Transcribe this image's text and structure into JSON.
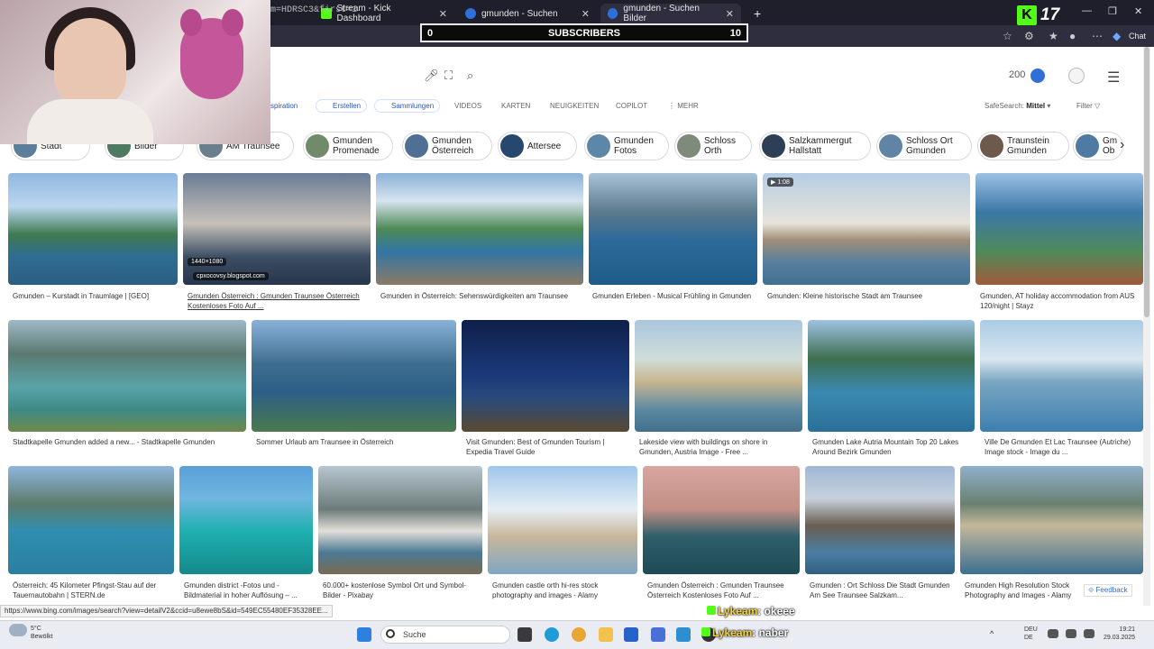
{
  "browser": {
    "tabs": [
      {
        "label": "Stream - Kick Dashboard",
        "active": false
      },
      {
        "label": "gmunden - Suchen",
        "active": false
      },
      {
        "label": "gmunden - Suchen Bilder",
        "active": true
      }
    ],
    "url_fragment": "m=HDRSC3&first=1",
    "new_tab_icon": "+",
    "chat_label": "Chat"
  },
  "overlay": {
    "subs_left": "0",
    "subs_label": "SUBSCRIBERS",
    "subs_right": "10",
    "kick_letter": "K",
    "kick_number": "17"
  },
  "header": {
    "points": "200",
    "nav_tabs": [
      "spiration",
      "Erstellen",
      "Sammlungen",
      "VIDEOS",
      "KARTEN",
      "NEUIGKEITEN",
      "COPILOT",
      "MEHR"
    ],
    "safesearch_label": "SafeSearch:",
    "safesearch_value": "Mittel",
    "filter_label": "Filter"
  },
  "chips": [
    {
      "l1": "Stadt",
      "l2": "",
      "color": "#5b7f9a"
    },
    {
      "l1": "Bilder",
      "l2": "",
      "color": "#4e7a61"
    },
    {
      "l1": "AM Traunsee",
      "l2": "",
      "color": "#6a7f8c"
    },
    {
      "l1": "Gmunden",
      "l2": "Promenade",
      "color": "#708a6a"
    },
    {
      "l1": "Gmunden",
      "l2": "Österreich",
      "color": "#4f6f95"
    },
    {
      "l1": "Attersee",
      "l2": "",
      "color": "#27476e"
    },
    {
      "l1": "Gmunden",
      "l2": "Fotos",
      "color": "#5d87a8"
    },
    {
      "l1": "Schloss",
      "l2": "Orth",
      "color": "#7e8b7a"
    },
    {
      "l1": "Salzkammergut",
      "l2": "Hallstatt",
      "color": "#2d3f57"
    },
    {
      "l1": "Schloss Ort",
      "l2": "Gmunden",
      "color": "#5f84a5"
    },
    {
      "l1": "Traunstein",
      "l2": "Gmunden",
      "color": "#6d5a4d"
    },
    {
      "l1": "Gm",
      "l2": "Ob",
      "color": "#4f7aa3"
    }
  ],
  "results": {
    "row1": [
      "Gmunden – Kurstadt in Traumlage | [GEO]",
      "Gmunden Österreich : Gmunden Traunsee Österreich Kostenloses Foto Auf ...",
      "Gmunden in Österreich: Sehenswürdigkeiten am Traunsee",
      "Gmunden Erleben - Musical Frühling in Gmunden",
      "Gmunden: Kleine historische Stadt am Traunsee",
      "Gmunden, AT holiday accommodation from AUS 120/night | Stayz"
    ],
    "row2": [
      "Stadtkapelle Gmunden added a new... - Stadtkapelle Gmunden",
      "Sommer Urlaub am Traunsee in Österreich",
      "Visit Gmunden: Best of Gmunden Tourism | Expedia Travel Guide",
      "Lakeside view with buildings on shore in Gmunden, Austria Image - Free ...",
      "Gmunden Lake Autria Mountain Top 20 Lakes Around Bezirk Gmunden",
      "Ville De Gmunden Et Lac Traunsee (Autriche) Image stock - Image du ..."
    ],
    "row3": [
      "Österreich: 45 Kilometer Pfingst-Stau auf der Tauernautobahn | STERN.de",
      "Gmunden district -Fotos und -Bildmaterial in hoher Auflösung – ...",
      "60.000+ kostenlose Symbol Ort und Symbol-Bilder - Pixabay",
      "Gmunden castle orth hi-res stock photography and images - Alamy",
      "Gmunden Österreich : Gmunden Traunsee Österreich Kostenloses Foto Auf ...",
      "Gmunden : Ort Schloss Die Stadt Gmunden Am See Traunsee Salzkam...",
      "Gmunden High Resolution Stock Photography and Images - Alamy"
    ],
    "hover_resolution": "1440×1080",
    "hover_source": "cpxocovsy.blogspot.com",
    "video_duration": "1:08"
  },
  "status_url": "https://www.bing.com/images/search?view=detailV2&ccid=u8ewe8bS&id=549EC55480EF35328EE...",
  "feedback_label": "Feedback",
  "taskbar": {
    "weather_temp": "5°C",
    "weather_text": "Bewölkt",
    "search_label": "Suche",
    "lang_top": "DEU",
    "lang_bottom": "DE",
    "time": "19:21",
    "date": "29.03.2025"
  },
  "chat": [
    {
      "user": "Lykeam",
      "msg": ": okeee"
    },
    {
      "user": "Lykeam",
      "msg": ": naber"
    }
  ]
}
